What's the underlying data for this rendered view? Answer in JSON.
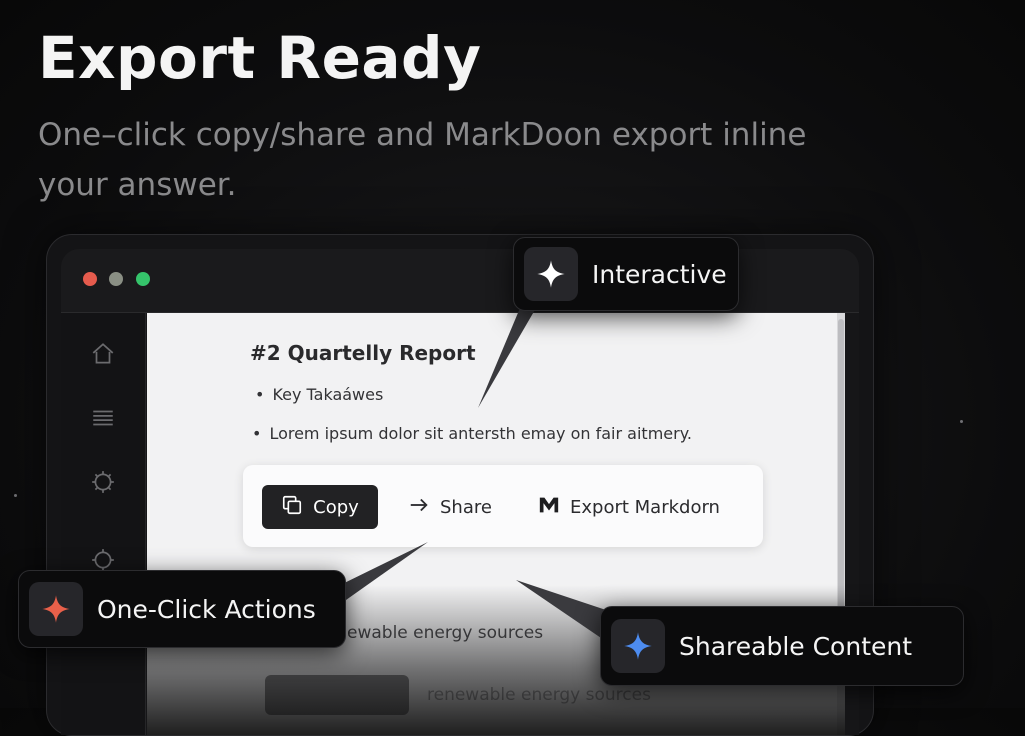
{
  "hero": {
    "title": "Export Ready",
    "subtitle": "One–click copy/share and MarkDoon export inline  your answer."
  },
  "window": {
    "traffic_lights": {
      "close": "#e55b4d",
      "minimize": "#8a8f84",
      "zoom": "#35c46b"
    },
    "sidebar_icons": [
      "home-icon",
      "menu-lines-icon",
      "settings-gear-icon",
      "settings-cog-icon",
      "hexagon-icon"
    ],
    "document": {
      "title": "#2 Quartelly Report",
      "bullets": [
        "Key Takaáwes",
        "Lorem ipsum dolor sit antersth emay on fair aitmery."
      ],
      "actions": {
        "copy_label": "Copy",
        "share_label": "Share",
        "export_label": "Export Markdorn"
      },
      "faded_lines": [
        "ewable energy sources",
        "renewable energy sources"
      ]
    }
  },
  "callouts": {
    "interactive": {
      "label": "Interactive",
      "icon": "sparkle-icon",
      "color": "#ffffff"
    },
    "one_click": {
      "label": "One-Click Actions",
      "icon": "sparkle-icon",
      "color": "#e8604a"
    },
    "shareable": {
      "label": "Shareable Content",
      "icon": "sparkle-icon",
      "color": "#4d8cf0"
    }
  }
}
